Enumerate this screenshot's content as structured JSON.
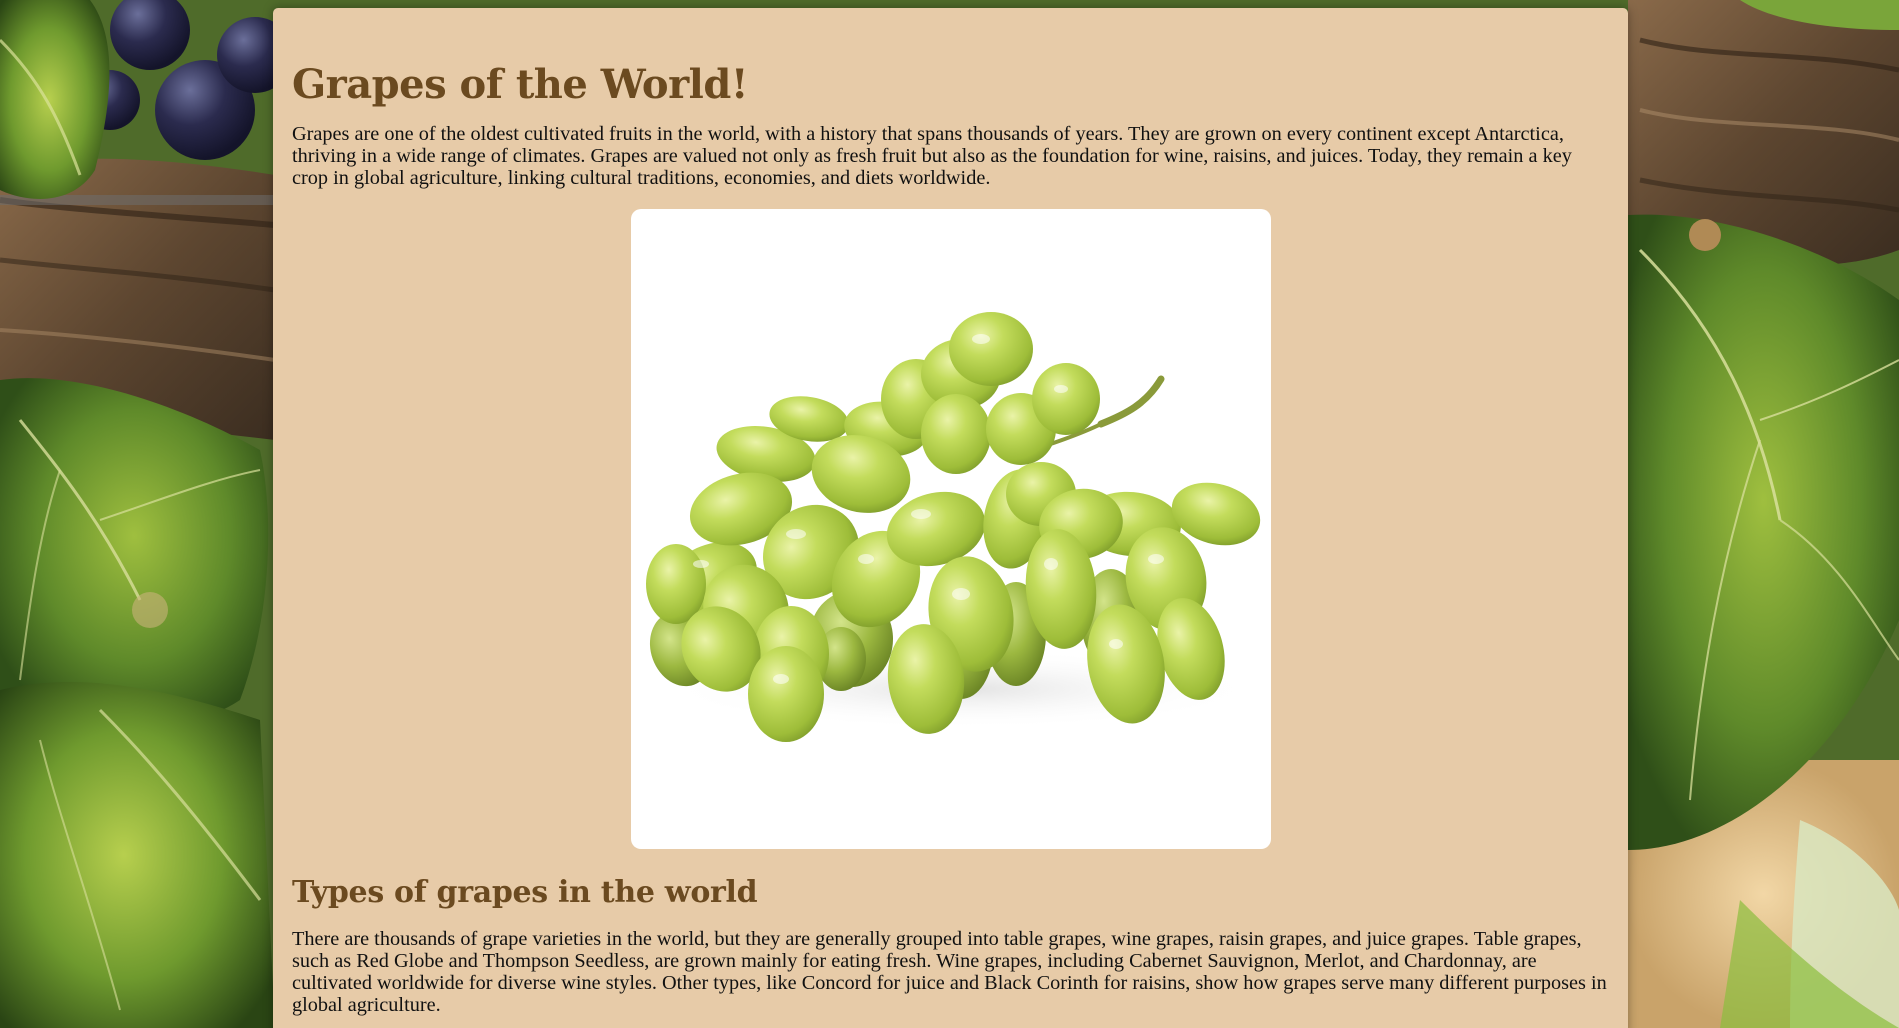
{
  "page": {
    "title": "Grapes of the World!",
    "intro": "Grapes are one of the oldest cultivated fruits in the world, with a history that spans thousands of years. They are grown on every continent except Antarctica, thriving in a wide range of climates. Grapes are valued not only as fresh fruit but also as the foundation for wine, raisins, and juices. Today, they remain a key crop in global agriculture, linking cultural traditions, economies, and diets worldwide.",
    "types_heading": "Types of grapes in the world",
    "types_text": "There are thousands of grape varieties in the world, but they are generally grouped into table grapes, wine grapes, raisin grapes, and juice grapes. Table grapes, such as Red Globe and Thompson Seedless, are grown mainly for eating fresh. Wine grapes, including Cabernet Sauvignon, Merlot, and Chardonnay, are cultivated worldwide for diverse wine styles. Other types, like Concord for juice and Black Corinth for raisins, show how grapes serve many different purposes in global agriculture."
  },
  "colors": {
    "panel_background": "#e7cba8",
    "heading": "#6b4a20",
    "body_text": "#111111",
    "grape_green": "#a8c94a"
  },
  "images": {
    "hero": "green-grape-bunch-image",
    "background": "vineyard-leaves-background-image"
  }
}
